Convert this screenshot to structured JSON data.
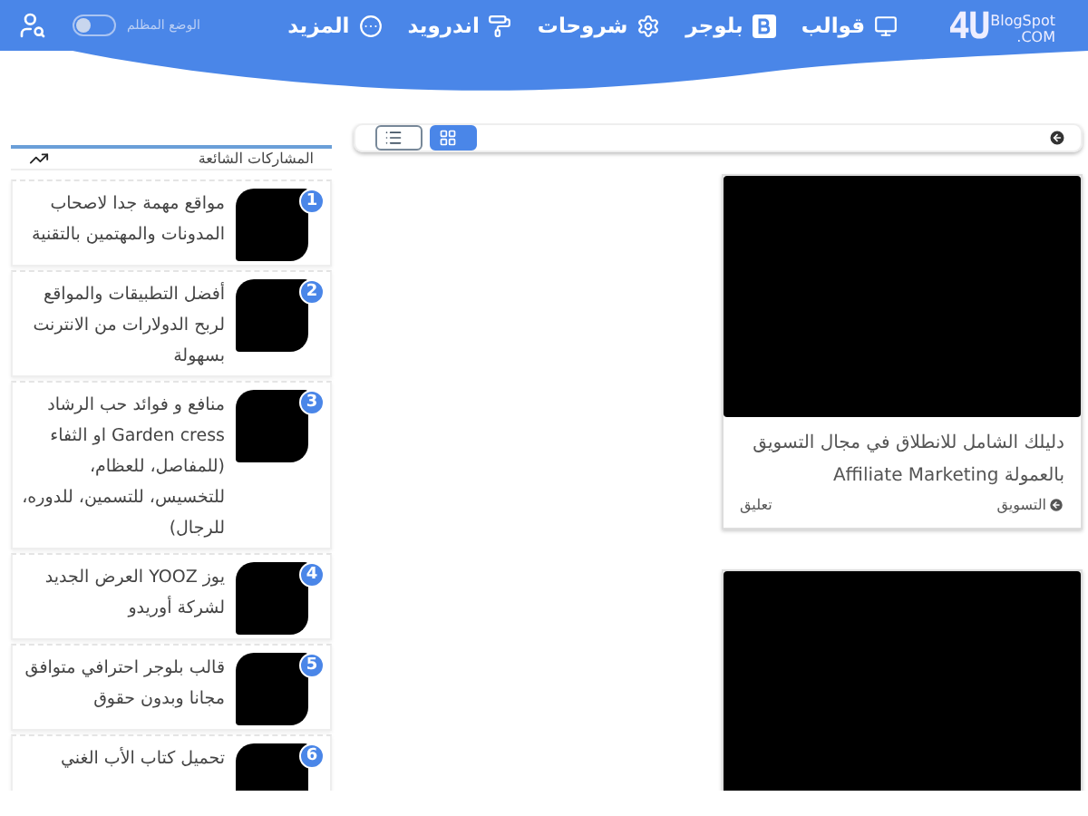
{
  "header": {
    "logo": {
      "main": "4U",
      "sub": "BlogSpot",
      "domain": ".COM"
    },
    "nav": [
      {
        "label": "قوالب"
      },
      {
        "label": "بلوجر"
      },
      {
        "label": "شروحات"
      },
      {
        "label": "اندرويد"
      },
      {
        "label": "المزيد"
      }
    ],
    "dark_mode": {
      "label": "الوضع المظلم",
      "on": false
    }
  },
  "toolbar": {
    "views": [
      {
        "kind": "list",
        "selected": false
      },
      {
        "kind": "grid",
        "selected": true
      }
    ]
  },
  "posts": [
    {
      "kind": "article",
      "title": "دليلك الشامل للانطلاق في مجال التسويق بالعمولة Affiliate Marketing",
      "category": "التسويق",
      "comments": "تعليق"
    },
    {
      "kind": "picture"
    }
  ],
  "sidebar": {
    "title": "المشاركات الشائعة",
    "items": [
      {
        "number": "1",
        "title": "مواقع مهمة جدا لاصحاب المدونات والمهتمين بالتقنية"
      },
      {
        "number": "2",
        "title": "أفضل التطبيقات والمواقع لربح الدولارات من الانترنت بسهولة"
      },
      {
        "number": "3",
        "title": "منافع و فوائد حب الرشاد Garden cress او الثفاء (للمفاصل، للعظام، للتخسيس، للتسمين، للدوره، للرجال)"
      },
      {
        "number": "4",
        "title": "يوز YOOZ العرض الجديد لشركة أوريدو"
      },
      {
        "number": "5",
        "title": "قالب بلوجر احترافي متوافق مجانا وبدون حقوق"
      },
      {
        "number": "6",
        "title": "تحميل كتاب الأب الغني"
      }
    ]
  }
}
